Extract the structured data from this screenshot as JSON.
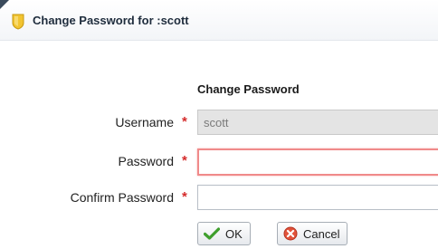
{
  "dialog": {
    "title": "Change Password for :scott",
    "title_icon": "shield-icon",
    "section_title": "Change Password"
  },
  "form": {
    "username": {
      "label": "Username",
      "required_marker": "*",
      "value": "scott"
    },
    "password": {
      "label": "Password",
      "required_marker": "*",
      "value": ""
    },
    "confirm_password": {
      "label": "Confirm Password",
      "required_marker": "*",
      "value": ""
    }
  },
  "buttons": {
    "ok": {
      "label": "OK",
      "icon": "checkmark-icon"
    },
    "cancel": {
      "label": "Cancel",
      "icon": "cancel-icon"
    }
  },
  "colors": {
    "required": "#d52b2b",
    "error_border": "#f08a8a",
    "ok_icon": "#3f9f2d",
    "cancel_icon": "#e2533b",
    "title_icon": "#f2c431"
  }
}
